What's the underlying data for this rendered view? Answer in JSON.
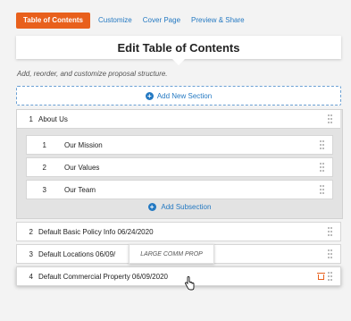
{
  "tabs": {
    "active": "Table of Contents",
    "customize": "Customize",
    "cover_page": "Cover Page",
    "preview_share": "Preview & Share"
  },
  "header": {
    "title": "Edit Table of Contents",
    "subtitle": "Add, reorder, and customize proposal structure."
  },
  "add_section_label": "Add New Section",
  "sections": [
    {
      "num": "1",
      "name": "About Us",
      "subsections": [
        {
          "num": "1",
          "name": "Our Mission"
        },
        {
          "num": "2",
          "name": "Our Values"
        },
        {
          "num": "3",
          "name": "Our Team"
        }
      ],
      "add_subsection_label": "Add Subsection"
    },
    {
      "num": "2",
      "name": "Default Basic Policy Info 06/24/2020"
    },
    {
      "num": "3",
      "name": "Default Locations 06/09/"
    },
    {
      "num": "4",
      "name": "Default Commercial Property 06/09/2020"
    }
  ],
  "tooltip": "LARGE COMM PROP",
  "colors": {
    "accent": "#e8601c",
    "link": "#2479c2"
  }
}
